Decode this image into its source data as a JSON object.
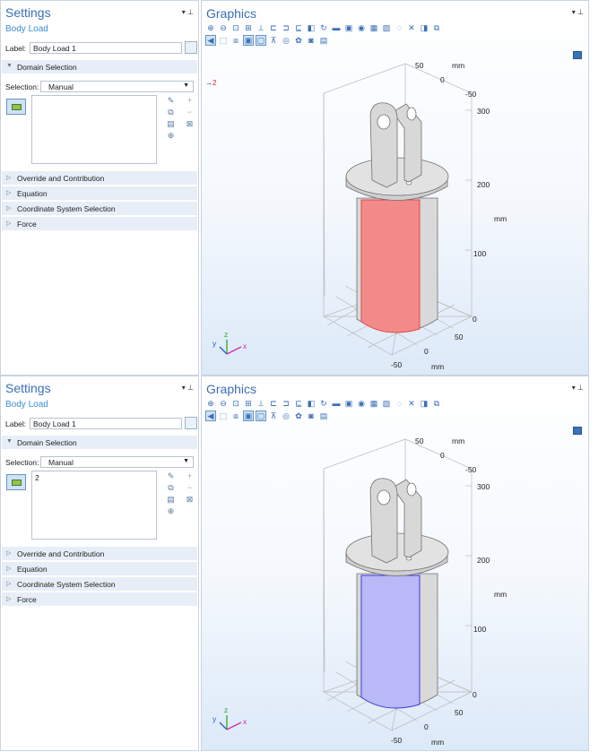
{
  "panels": [
    {
      "settings": {
        "title": "Settings",
        "subtitle": "Body Load",
        "label_caption": "Label:",
        "label_value": "Body Load 1",
        "domain_section": "Domain Selection",
        "selection_caption": "Selection:",
        "selection_value": "Manual",
        "selected_domains": "",
        "sections": [
          "Override and Contribution",
          "Equation",
          "Coordinate System Selection",
          "Force"
        ]
      },
      "graphics": {
        "title": "Graphics",
        "highlight_color": "#f28a8a",
        "highlight_edge": "#e04848",
        "marker_label": "2",
        "axis": {
          "t50": "50",
          "tmm": "mm",
          "t0": "0",
          "tm50": "-50",
          "z300": "300",
          "z200": "200",
          "zmm": "mm",
          "z100": "100",
          "z0": "0",
          "b50": "50",
          "b0": "0",
          "bm50": "-50",
          "bmm": "mm"
        },
        "triad": {
          "x": "x",
          "y": "y",
          "z": "z"
        }
      }
    },
    {
      "settings": {
        "title": "Settings",
        "subtitle": "Body Load",
        "label_caption": "Label:",
        "label_value": "Body Load 1",
        "domain_section": "Domain Selection",
        "selection_caption": "Selection:",
        "selection_value": "Manual",
        "selected_domains": "2",
        "sections": [
          "Override and Contribution",
          "Equation",
          "Coordinate System Selection",
          "Force"
        ]
      },
      "graphics": {
        "title": "Graphics",
        "highlight_color": "#b9b9f7",
        "highlight_edge": "#3a3ae0",
        "marker_label": "",
        "axis": {
          "t50": "50",
          "tmm": "mm",
          "t0": "0",
          "tm50": "-50",
          "z300": "300",
          "z200": "200",
          "zmm": "mm",
          "z100": "100",
          "z0": "0",
          "b50": "50",
          "b0": "0",
          "bm50": "-50",
          "bmm": "mm"
        },
        "triad": {
          "x": "x",
          "y": "y",
          "z": "z"
        }
      }
    }
  ],
  "icons": {
    "pin": "pin-icon",
    "label_button": "label-pane-icon",
    "domain_button": "domain-selection-icon",
    "corner": "graphics-settings-icon"
  }
}
